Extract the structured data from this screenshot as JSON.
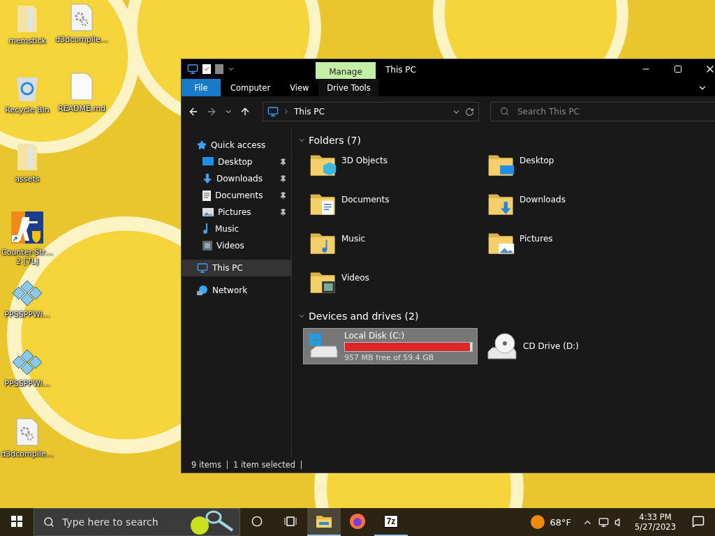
{
  "desktop_icons": [
    {
      "label": "memstick",
      "kind": "folder"
    },
    {
      "label": "Recycle Bin",
      "kind": "recycle"
    },
    {
      "label": "assets",
      "kind": "folder"
    },
    {
      "label": "Counter-Str… 2 [7L]",
      "kind": "game"
    },
    {
      "label": "PPSSPPWi…",
      "kind": "ppsspp"
    },
    {
      "label": "PPSSPPWi…",
      "kind": "ppsspp"
    },
    {
      "label": "d3dcompile…",
      "kind": "settings-file"
    },
    {
      "label": "d3dcompile…",
      "kind": "settings-file"
    },
    {
      "label": "README.md",
      "kind": "file"
    }
  ],
  "window": {
    "title": "This PC",
    "context_tab": "Manage",
    "ribbon_tabs": [
      {
        "label": "File",
        "kind": "file"
      },
      {
        "label": "Computer",
        "kind": "plain"
      },
      {
        "label": "View",
        "kind": "plain"
      },
      {
        "label": "Drive Tools",
        "kind": "context"
      }
    ],
    "nav_buttons": [
      {
        "kind": "back",
        "disabled": false
      },
      {
        "kind": "forward",
        "disabled": true
      },
      {
        "kind": "recent",
        "disabled": false
      },
      {
        "kind": "up",
        "disabled": false
      }
    ],
    "address": "This PC",
    "search": {
      "placeholder": "Search This PC"
    }
  },
  "sidebar": [
    {
      "label": "Quick access",
      "kind": "star",
      "selected": false,
      "children": [
        {
          "label": "Desktop",
          "kind": "desktop",
          "selected": false,
          "pinned": true
        },
        {
          "label": "Downloads",
          "kind": "downloads",
          "selected": false,
          "pinned": true
        },
        {
          "label": "Documents",
          "kind": "documents",
          "selected": false,
          "pinned": true
        },
        {
          "label": "Pictures",
          "kind": "pictures",
          "selected": false,
          "pinned": true
        },
        {
          "label": "Music",
          "kind": "music",
          "selected": false,
          "pinned": false
        },
        {
          "label": "Videos",
          "kind": "videos",
          "selected": false,
          "pinned": false
        }
      ]
    },
    {
      "label": "This PC",
      "kind": "pc",
      "selected": true
    },
    {
      "label": "Network",
      "kind": "network",
      "selected": false
    }
  ],
  "groups": [
    {
      "title": "Folders (7)",
      "expanded": true,
      "items": [
        {
          "label": "3D Objects",
          "kind": "objects",
          "selected": false
        },
        {
          "label": "Desktop",
          "kind": "desktop",
          "selected": false
        },
        {
          "label": "Documents",
          "kind": "documents",
          "selected": false
        },
        {
          "label": "Downloads",
          "kind": "downloads",
          "selected": false
        },
        {
          "label": "Music",
          "kind": "music",
          "selected": false
        },
        {
          "label": "Pictures",
          "kind": "pictures",
          "selected": false
        },
        {
          "label": "Videos",
          "kind": "videos",
          "selected": false
        }
      ]
    },
    {
      "title": "Devices and drives (2)",
      "expanded": true,
      "items": [
        {
          "label": "Local Disk (C:)",
          "kind": "disk",
          "selected": true,
          "level": 0.984,
          "free": "957 MB free of 59.4 GB"
        },
        {
          "label": "CD Drive (D:)",
          "kind": "cd",
          "selected": false
        }
      ]
    }
  ],
  "status_bar": [
    "9 items",
    "1 item selected"
  ],
  "taskbar": {
    "search": {
      "placeholder": "Type here to search"
    },
    "apps": [
      {
        "kind": "explorer",
        "running": true,
        "active": true
      },
      {
        "kind": "firefox",
        "running": false,
        "active": false
      },
      {
        "kind": "sevenzip",
        "text": "7z",
        "running": true,
        "active": false
      }
    ],
    "weather": "68°F",
    "time": "4:33 PM",
    "date": "5/27/2023"
  }
}
